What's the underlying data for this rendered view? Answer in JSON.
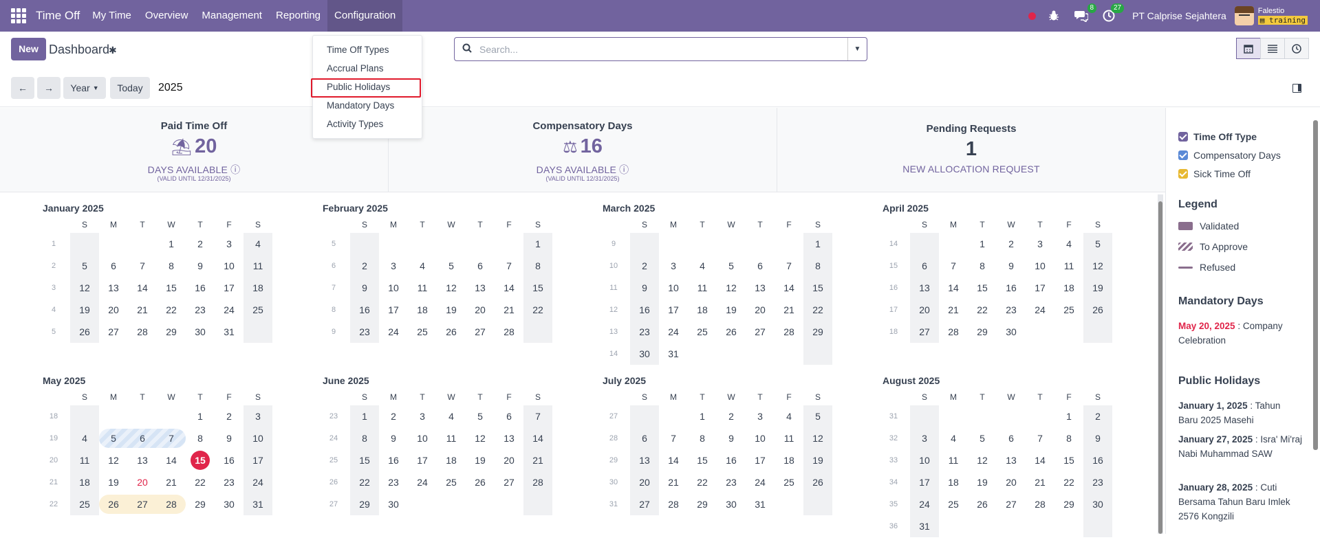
{
  "navbar": {
    "brand": "Time Off",
    "menus": [
      "My Time",
      "Overview",
      "Management",
      "Reporting",
      "Configuration"
    ],
    "messages_badge": "8",
    "activities_badge": "27",
    "company": "PT Calprise Sejahtera",
    "user_name": "Falestio",
    "user_db": "training"
  },
  "control_panel": {
    "new_label": "New",
    "breadcrumb": "Dashboard",
    "search_placeholder": "Search...",
    "prev_label": "←",
    "next_label": "→",
    "scale_label": "Year",
    "today_label": "Today",
    "period": "2025"
  },
  "config_menu": {
    "items": [
      "Time Off Types",
      "Accrual Plans",
      "Public Holidays",
      "Mandatory Days",
      "Activity Types"
    ],
    "highlighted": "Public Holidays"
  },
  "summary": {
    "cards": [
      {
        "title": "Paid Time Off",
        "value": "20",
        "sub": "DAYS AVAILABLE",
        "valid": "(VALID UNTIL 12/31/2025)"
      },
      {
        "title": "Compensatory Days",
        "value": "16",
        "sub": "DAYS AVAILABLE",
        "valid": "(VALID UNTIL 12/31/2025)"
      },
      {
        "title": "Pending Requests",
        "value": "1",
        "sub": "NEW ALLOCATION REQUEST"
      }
    ]
  },
  "calendar": {
    "dow": [
      "S",
      "M",
      "T",
      "W",
      "T",
      "F",
      "S"
    ],
    "months": [
      {
        "name": "January 2025",
        "start": 3,
        "days": 31,
        "first_week": 1
      },
      {
        "name": "February 2025",
        "start": 6,
        "days": 28,
        "first_week": 5
      },
      {
        "name": "March 2025",
        "start": 6,
        "days": 31,
        "first_week": 9
      },
      {
        "name": "April 2025",
        "start": 2,
        "days": 30,
        "first_week": 14
      },
      {
        "name": "May 2025",
        "start": 4,
        "days": 31,
        "first_week": 18
      },
      {
        "name": "June 2025",
        "start": 0,
        "days": 30,
        "first_week": 23
      },
      {
        "name": "July 2025",
        "start": 2,
        "days": 31,
        "first_week": 27
      },
      {
        "name": "August 2025",
        "start": 5,
        "days": 31,
        "first_week": 31
      }
    ],
    "today": {
      "month": 4,
      "day": 15
    },
    "mandatory": {
      "month": 4,
      "day": 20
    }
  },
  "side_panel": {
    "filters": [
      {
        "label": "Time Off Type",
        "color": "#71639e",
        "bold": true
      },
      {
        "label": "Compensatory Days",
        "color": "#5b8ad6",
        "bold": false
      },
      {
        "label": "Sick Time Off",
        "color": "#e8b932",
        "bold": false
      }
    ],
    "legend_title": "Legend",
    "legend": [
      "Validated",
      "To Approve",
      "Refused"
    ],
    "mandatory_title": "Mandatory Days",
    "mandatory_date": "May 20, 2025",
    "mandatory_text": " : Company Celebration",
    "public_title": "Public Holidays",
    "public_holidays": [
      {
        "date": "January 1, 2025",
        "text": " : Tahun Baru 2025 Masehi"
      },
      {
        "date": "January 27, 2025",
        "text": " : Isra' Mi'raj Nabi Muhammad SAW"
      },
      {
        "date": "January 28, 2025",
        "text": " : Cuti Bersama Tahun Baru Imlek 2576 Kongzili"
      }
    ]
  }
}
